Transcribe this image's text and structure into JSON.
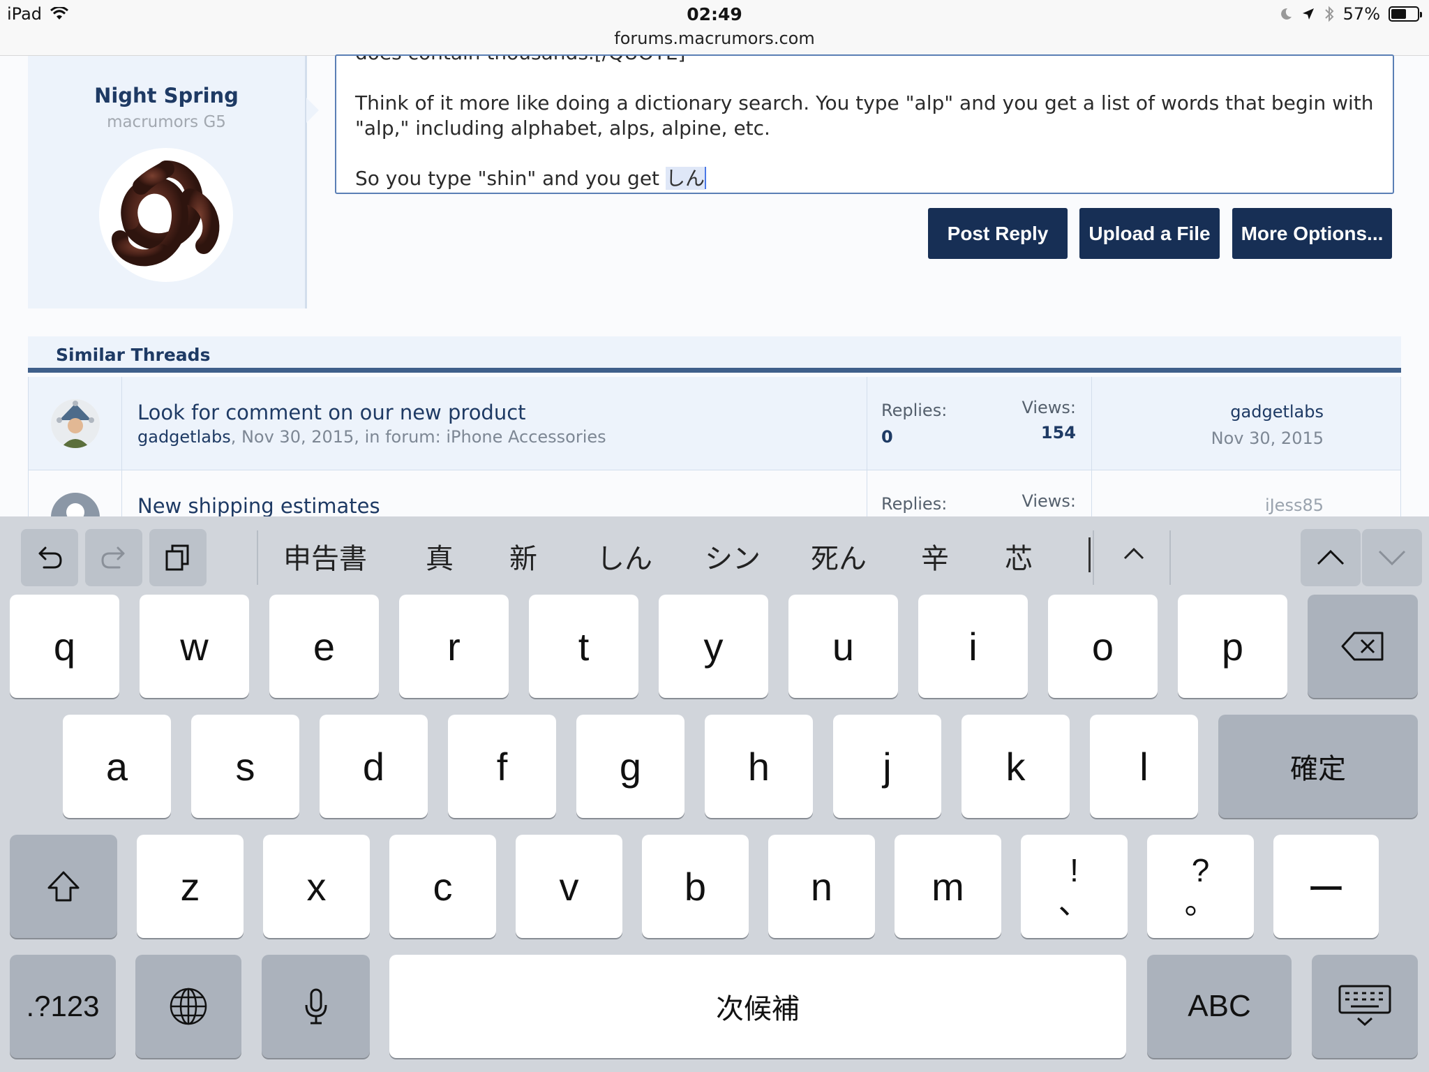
{
  "status_bar": {
    "device": "iPad",
    "time": "02:49",
    "url": "forums.macrumors.com",
    "battery": "57%",
    "battery_level": 0.57
  },
  "post": {
    "author_name": "Night Spring",
    "author_title": "macrumors G5",
    "editor_lines": [
      "does contain thousands.[/QUOTE]",
      "",
      "Think of it more like doing a dictionary search. You type \"alp\" and you get a list of words that begin with \"alp,\" including alphabet, alps, alpine, etc.",
      "",
      "So you type \"shin\" and you get "
    ],
    "composing_text": "しん"
  },
  "buttons": {
    "post_reply": "Post Reply",
    "upload_file": "Upload a File",
    "more_options": "More Options..."
  },
  "similar_threads": {
    "header": "Similar Threads",
    "threads": [
      {
        "title": "Look for comment on our new product",
        "author": "gadgetlabs",
        "meta": ", Nov 30, 2015, in forum: iPhone Accessories",
        "replies_label": "Replies:",
        "replies": "0",
        "views_label": "Views:",
        "views": "154",
        "last_user": "gadgetlabs",
        "last_date": "Nov 30, 2015"
      },
      {
        "title": "New shipping estimates",
        "replies_label": "Replies:",
        "views_label": "Views:",
        "last_user": "iJess85"
      }
    ]
  },
  "keyboard": {
    "candidates": [
      "申告書",
      "真",
      "新",
      "しん",
      "シン",
      "死ん",
      "辛",
      "芯"
    ],
    "row1": [
      "q",
      "w",
      "e",
      "r",
      "t",
      "y",
      "u",
      "i",
      "o",
      "p"
    ],
    "row2": [
      "a",
      "s",
      "d",
      "f",
      "g",
      "h",
      "j",
      "k",
      "l"
    ],
    "confirm": "確定",
    "row3": [
      "z",
      "x",
      "c",
      "v",
      "b",
      "n",
      "m"
    ],
    "punct1_top": "!",
    "punct1_bottom": "、",
    "punct2_top": "?",
    "punct2_bottom": "。",
    "dash": "ー",
    "numbers": ".?123",
    "space": "次候補",
    "abc": "ABC"
  }
}
